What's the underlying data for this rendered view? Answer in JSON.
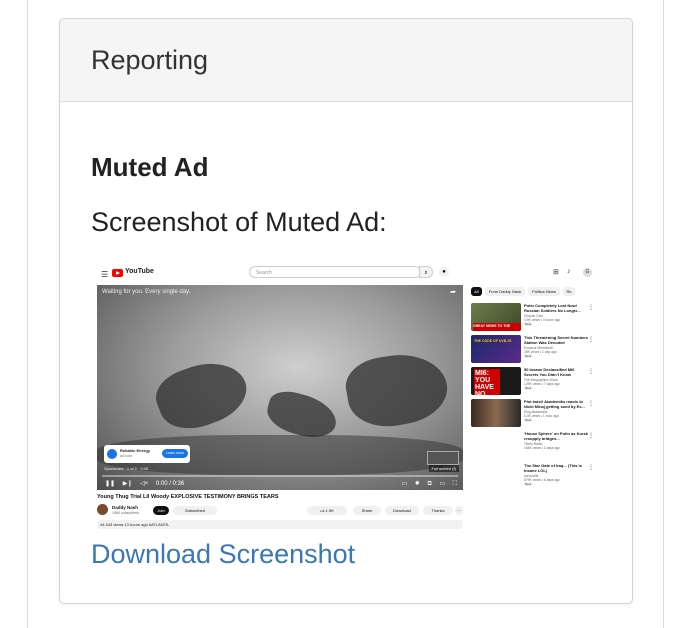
{
  "panel": {
    "heading": "Reporting",
    "section_title": "Muted Ad",
    "caption": "Screenshot of Muted Ad:",
    "download_link": "Download Screenshot"
  },
  "screenshot": {
    "logo_text": "YouTube",
    "search_placeholder": "Search",
    "video_overlay_title": "Waiting for you. Every single day.",
    "ad": {
      "name": "Reliable Energy",
      "sub": "Ad com",
      "cta": "Learn more",
      "sponsor_line": "Sponsored · 1 of 2 · 0:28"
    },
    "fullscreen_label": "Full screen (f)",
    "time": "0:00 / 0:36",
    "video_title": "Young Thug Trial Lil Woody EXPLOSIVE TESTIMONY BRINGS TEARS",
    "channel_name": "Daddy Nash",
    "channel_subs": "196K subscribers",
    "join_label": "Join",
    "subscribed_label": "Subscribed",
    "likes": "1.9K",
    "share_label": "Share",
    "download_label": "Download",
    "thanks_label": "Thanks",
    "views_line": "44,943 views  13 hours ago  #ATLANTA",
    "chips": [
      "All",
      "From Daddy Nash",
      "Politics News",
      "Re"
    ],
    "recommendations": [
      {
        "title": "Putin Completely Lost Now! Russian Soldiers No Longer...",
        "channel": "Chaotic Cats",
        "views": "4.9K views • 3 hours ago",
        "badge": "New",
        "thumb_text": "GREAT NEWS TO THE WORLD"
      },
      {
        "title": "This Threatening Secret Numbers Station Was Decoded",
        "channel": "Emperor Mimofordil",
        "views": "28K views • 1 day ago",
        "badge": "New",
        "thumb_text": "THE CODE OF UVB-76"
      },
      {
        "title": "50 Insane Declassified MI6 Secrets You Didn't Know",
        "channel": "The Infographics Show",
        "views": "129K views • 7 days ago",
        "badge": "New",
        "thumb_text": "MI6: YOU HAVE NO IDEA"
      },
      {
        "title": "Plot twist! Akademiks reacts to Nicki Minaj getting sued by Ex...",
        "channel": "King Akademiks",
        "views": "6.3K views • 1 hour ago",
        "badge": "New",
        "thumb_text": ""
      },
      {
        "title": "'House Sphere' on Putin as Kursk resupply bridges...",
        "channel": "Times Radio",
        "views": "164K views • 1 days ago",
        "badge": "",
        "thumb_text": ""
      },
      {
        "title": "The Star Gate of Iraq... (This is Insane LOL)",
        "channel": "sunnyville",
        "views": "579K views • 6 days ago",
        "badge": "New",
        "thumb_text": ""
      }
    ]
  },
  "colors": {
    "link": "#3a77b6",
    "heading_bg": "#f5f5f5",
    "youtube_red": "#ff0000"
  }
}
